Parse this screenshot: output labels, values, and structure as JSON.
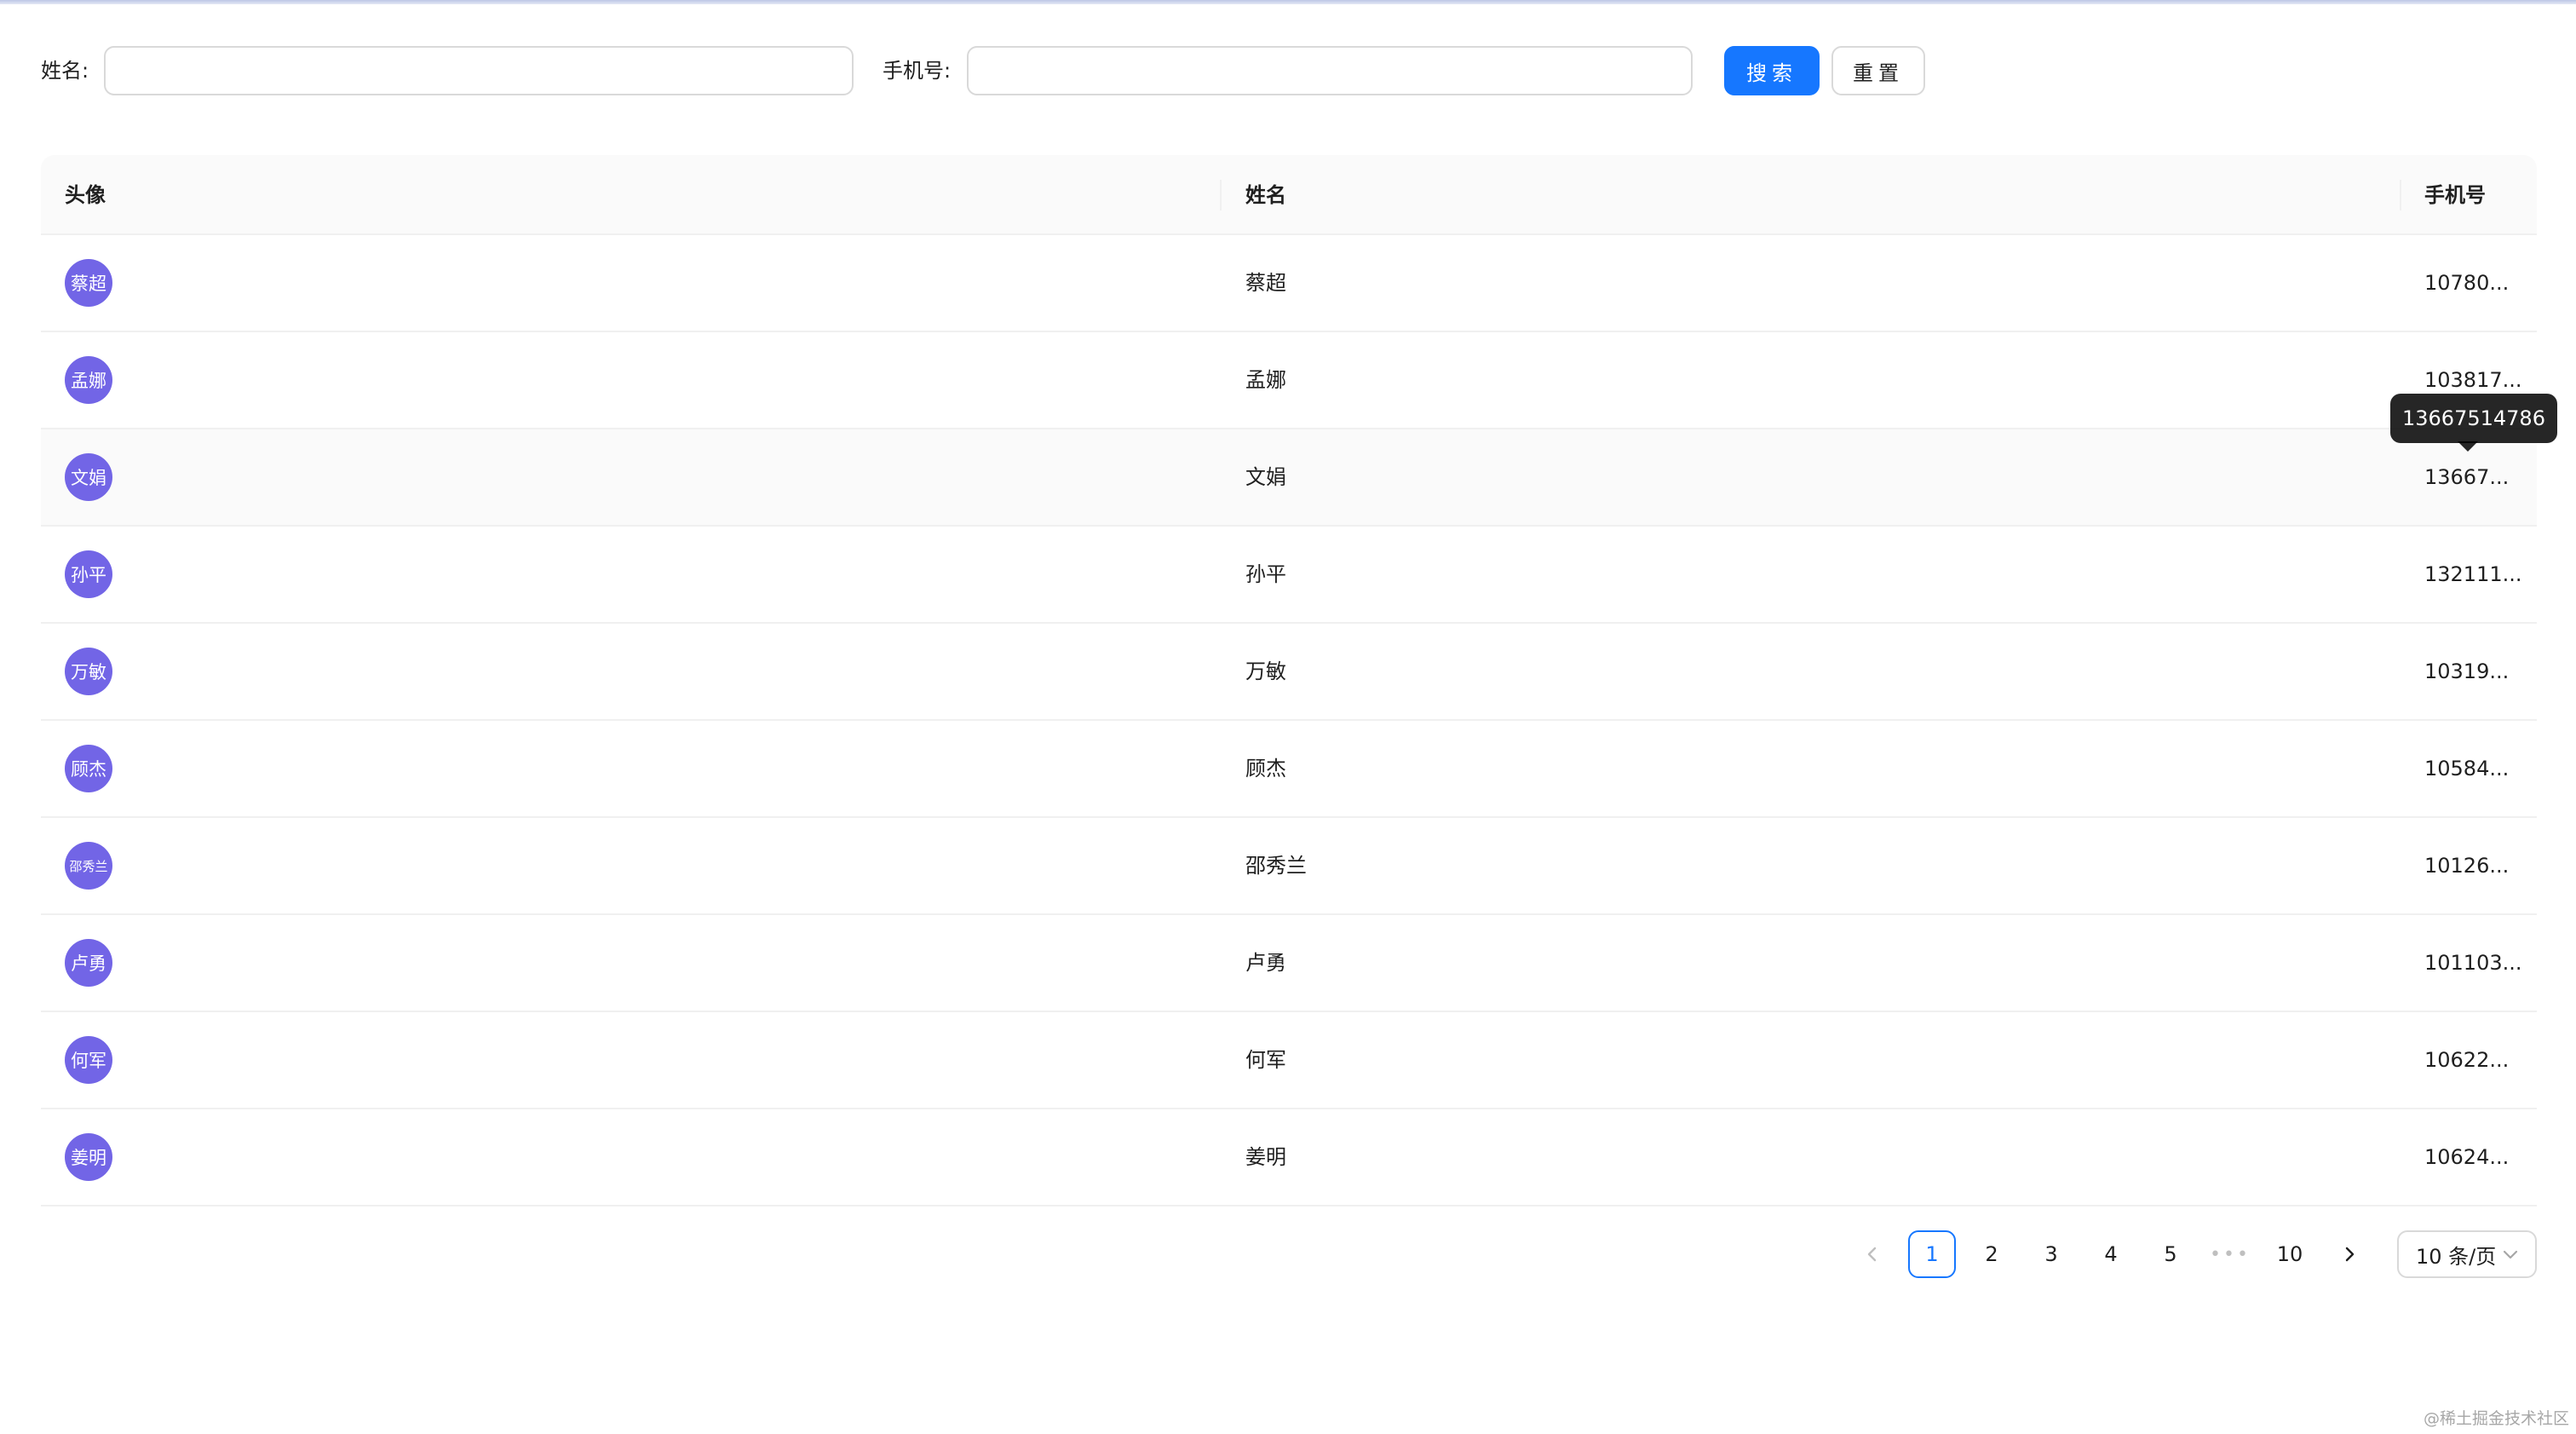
{
  "search_form": {
    "name_label": "姓名:",
    "name_value": "",
    "phone_label": "手机号:",
    "phone_value": "",
    "search_button": "搜索",
    "reset_button": "重置"
  },
  "table": {
    "columns": [
      "头像",
      "姓名",
      "手机号"
    ],
    "rows": [
      {
        "avatar": "蔡超",
        "name": "蔡超",
        "phone": "10780..."
      },
      {
        "avatar": "孟娜",
        "name": "孟娜",
        "phone": "103817..."
      },
      {
        "avatar": "文娟",
        "name": "文娟",
        "phone": "13667..."
      },
      {
        "avatar": "孙平",
        "name": "孙平",
        "phone": "132111..."
      },
      {
        "avatar": "万敏",
        "name": "万敏",
        "phone": "10319..."
      },
      {
        "avatar": "顾杰",
        "name": "顾杰",
        "phone": "10584..."
      },
      {
        "avatar": "邵秀兰",
        "name": "邵秀兰",
        "phone": "10126..."
      },
      {
        "avatar": "卢勇",
        "name": "卢勇",
        "phone": "101103..."
      },
      {
        "avatar": "何军",
        "name": "何军",
        "phone": "10622..."
      },
      {
        "avatar": "姜明",
        "name": "姜明",
        "phone": "10624..."
      }
    ]
  },
  "tooltip": {
    "text": "13667514786"
  },
  "pagination": {
    "prev_icon": "chevron-left-icon",
    "pages": [
      "1",
      "2",
      "3",
      "4",
      "5"
    ],
    "ellipsis": "•••",
    "last_page": "10",
    "next_icon": "chevron-right-icon",
    "current": "1",
    "page_size": "10 条/页"
  },
  "watermark": "@稀土掘金技术社区",
  "colors": {
    "primary": "#1677ff",
    "avatar_bg": "#7265e6",
    "header_bg": "#fafafa",
    "border": "#d9d9d9"
  }
}
